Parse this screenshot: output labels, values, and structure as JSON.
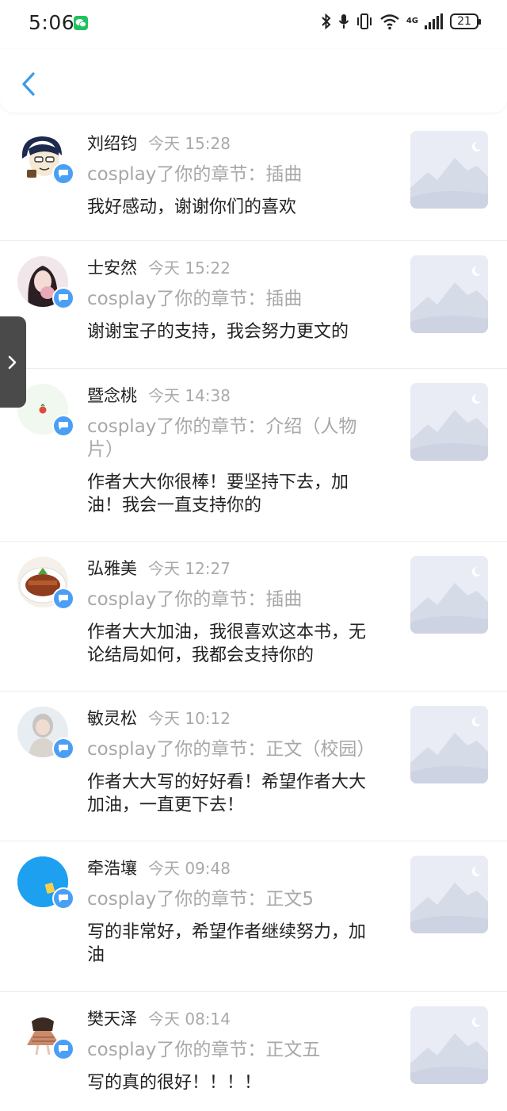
{
  "status_bar": {
    "time": "5:06",
    "network": "4G",
    "battery": "21"
  },
  "header": {
    "back_icon": "chevron-left-icon"
  },
  "items": [
    {
      "name": "刘绍钧",
      "time": "今天 15:28",
      "subtitle": "cosplay了你的章节：插曲",
      "content": "我好感动，谢谢你们的喜欢"
    },
    {
      "name": "士安然",
      "time": "今天 15:22",
      "subtitle": "cosplay了你的章节：插曲",
      "content": "谢谢宝子的支持，我会努力更文的"
    },
    {
      "name": "暨念桃",
      "time": "今天 14:38",
      "subtitle": "cosplay了你的章节：介绍（人物片）",
      "content": "作者大大你很棒！要坚持下去，加油！我会一直支持你的"
    },
    {
      "name": "弘雅美",
      "time": "今天 12:27",
      "subtitle": "cosplay了你的章节：插曲",
      "content": "作者大大加油，我很喜欢这本书，无论结局如何，我都会支持你的"
    },
    {
      "name": "敏灵松",
      "time": "今天 10:12",
      "subtitle": "cosplay了你的章节：正文（校园）",
      "content": "作者大大写的好好看！希望作者大大加油，一直更下去！"
    },
    {
      "name": "牵浩壤",
      "time": "今天 09:48",
      "subtitle": "cosplay了你的章节：正文5",
      "content": "写的非常好，希望作者继续努力，加油"
    },
    {
      "name": "樊天泽",
      "time": "今天 08:14",
      "subtitle": "cosplay了你的章节：正文五",
      "content": "写的真的很好！！！！"
    }
  ],
  "colors": {
    "accent": "#4a9ff5",
    "secondary_text": "#a8a8a8"
  }
}
